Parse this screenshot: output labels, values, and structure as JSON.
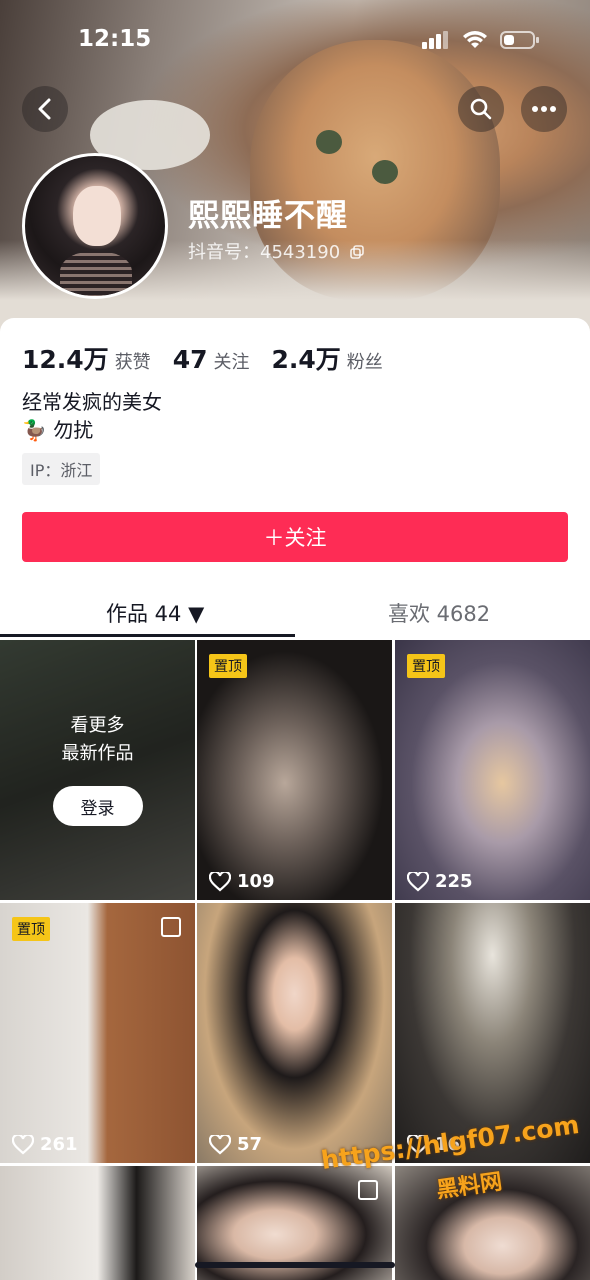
{
  "status": {
    "time": "12:15"
  },
  "profile": {
    "nickname": "熙熙睡不醒",
    "douyin_id_label": "抖音号：",
    "douyin_id": "4543190",
    "stats": [
      {
        "value": "12.4万",
        "label": "获赞"
      },
      {
        "value": "47",
        "label": "关注"
      },
      {
        "value": "2.4万",
        "label": "粉丝"
      }
    ],
    "bio_line1": "经常发疯的美女",
    "bio_line2": "🦆 勿扰",
    "ip": "IP：浙江"
  },
  "follow_button": "＋关注",
  "tabs": {
    "works": "作品 44 ▼",
    "likes": "喜欢 4682"
  },
  "grid": {
    "login_text_1": "看更多",
    "login_text_2": "最新作品",
    "login_button": "登录",
    "pinned_label": "置顶",
    "tiles": [
      {
        "likes": "109"
      },
      {
        "likes": "225"
      },
      {
        "likes": "261"
      },
      {
        "likes": "57"
      },
      {
        "likes": "16"
      }
    ]
  },
  "watermark": {
    "url": "https://hlgf07.com",
    "site": "黑料网"
  },
  "colors": {
    "accent": "#fe2c55",
    "pin": "#f5c518"
  }
}
